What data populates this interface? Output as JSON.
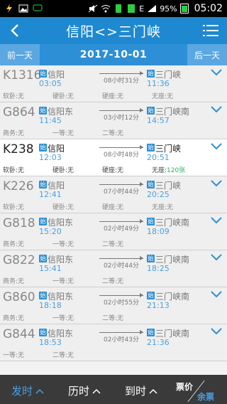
{
  "status_bar": {
    "time": "05:02",
    "battery": "95%",
    "signal_label": "E"
  },
  "header": {
    "title": "信阳<>三门峡"
  },
  "date_bar": {
    "prev_day": "前一天",
    "date": "2017-10-01",
    "next_day": "后一天"
  },
  "colors": {
    "header_bg": "#1e88d0",
    "datebar_bg": "#2d8fd5",
    "accent_blue": "#4a9fe0",
    "available_green": "#27ae60",
    "bottom_bg": "#3a3a3a"
  },
  "trains": [
    {
      "no": "K1316",
      "from": "信阳",
      "dep": "03:05",
      "duration": "08小时31分",
      "to": "三门峡",
      "arr": "11:36",
      "seats": [
        "软卧:无",
        "硬卧:无",
        "硬座:无",
        "无座:无"
      ]
    },
    {
      "no": "G864",
      "from": "信阳东",
      "dep": "11:45",
      "duration": "03小时12分",
      "to": "三门峡南",
      "arr": "14:57",
      "seats": [
        "商务:无",
        "一等:无",
        "二等:无",
        ""
      ]
    },
    {
      "no": "K238",
      "from": "信阳",
      "dep": "12:03",
      "duration": "08小时48分",
      "to": "三门峡",
      "arr": "20:51",
      "seats": [
        "软卧:无",
        "硬卧:无",
        "硬座:无",
        "无座:"
      ],
      "available": "120张"
    },
    {
      "no": "K226",
      "from": "信阳",
      "dep": "12:41",
      "duration": "07小时44分",
      "to": "三门峡",
      "arr": "20:25",
      "seats": [
        "软卧:无",
        "硬卧:无",
        "硬座:无",
        "无座:无"
      ]
    },
    {
      "no": "G818",
      "from": "信阳东",
      "dep": "15:20",
      "duration": "02小时49分",
      "to": "三门峡南",
      "arr": "18:09",
      "seats": [
        "商务:无",
        "一等:无",
        "二等:无",
        ""
      ]
    },
    {
      "no": "G822",
      "from": "信阳东",
      "dep": "15:41",
      "duration": "02小时44分",
      "to": "三门峡南",
      "arr": "18:25",
      "seats": [
        "商务:无",
        "一等:无",
        "二等:无",
        ""
      ]
    },
    {
      "no": "G860",
      "from": "信阳东",
      "dep": "18:18",
      "duration": "02小时55分",
      "to": "三门峡南",
      "arr": "21:13",
      "seats": [
        "商务:无",
        "一等:无",
        "二等:无",
        ""
      ]
    },
    {
      "no": "G844",
      "from": "信阳东",
      "dep": "18:53",
      "duration": "02小时43分",
      "to": "三门峡南",
      "arr": "21:36",
      "seats": [
        "一等:无",
        "二等:无",
        "",
        ""
      ]
    }
  ],
  "station_badge": "始",
  "bottom_bar": {
    "sort_departure": "发时",
    "sort_duration": "历时",
    "sort_arrival": "到时",
    "price": "票价",
    "tickets": "余票"
  }
}
